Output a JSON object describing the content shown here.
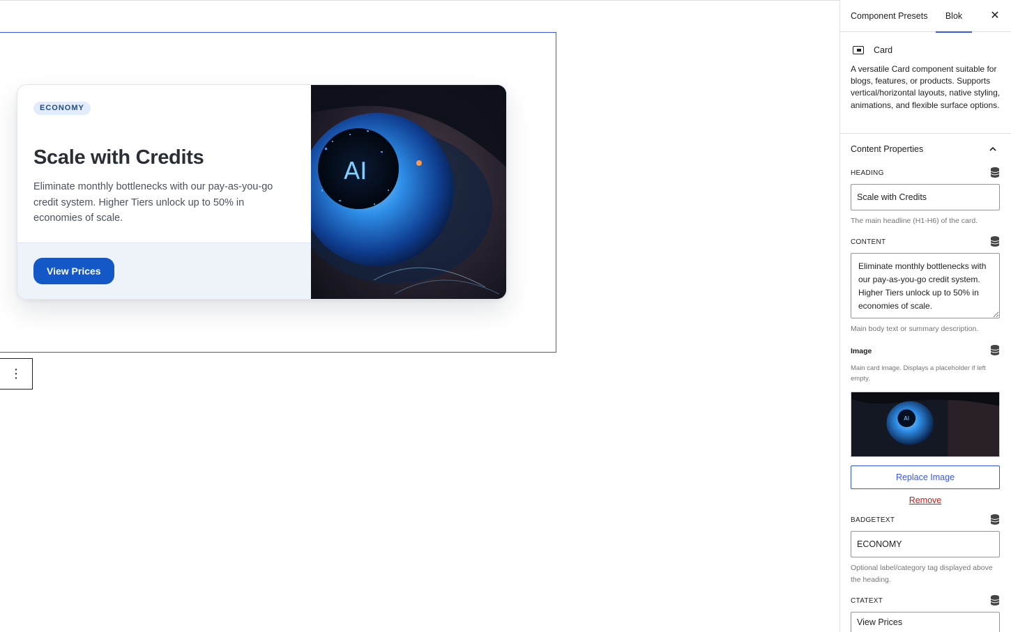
{
  "card": {
    "badge": "ECONOMY",
    "heading": "Scale with Credits",
    "content": "Eliminate monthly bottlenecks with our pay-as-you-go credit system. Higher Tiers unlock up to 50% in economies of scale.",
    "cta": "View Prices",
    "image_overlay": "AI"
  },
  "more_menu": {
    "icon": "⋮"
  },
  "sidebar": {
    "tabs": {
      "presets": "Component Presets",
      "blok": "Blok"
    },
    "close_icon": "✕",
    "block": {
      "title": "Card",
      "description": "A versatile Card component suitable for blogs, features, or products. Supports vertical/horizontal layouts, native styling, animations, and flexible surface options."
    },
    "panel_title": "Content Properties",
    "fields": {
      "heading": {
        "label": "HEADING",
        "value": "Scale with Credits",
        "help": "The main headline (H1-H6) of the card."
      },
      "content": {
        "label": "CONTENT",
        "value": "Eliminate monthly bottlenecks with our pay-as-you-go credit system. Higher Tiers unlock up to 50% in economies of scale.",
        "help": "Main body text or summary description."
      },
      "image": {
        "label": "Image",
        "help": "Main card image. Displays a placeholder if left empty.",
        "replace_label": "Replace Image",
        "remove_label": "Remove"
      },
      "badgetext": {
        "label": "BADGETEXT",
        "value": "ECONOMY",
        "help": "Optional label/category tag displayed above the heading."
      },
      "ctatext": {
        "label": "CTATEXT",
        "value": "View Prices"
      }
    }
  },
  "colors": {
    "accent": "#3858e9",
    "cta_bg": "#1458c8",
    "badge_bg": "#e3ecfa",
    "footer_bg": "#eef3fa",
    "danger": "#cc1818"
  }
}
